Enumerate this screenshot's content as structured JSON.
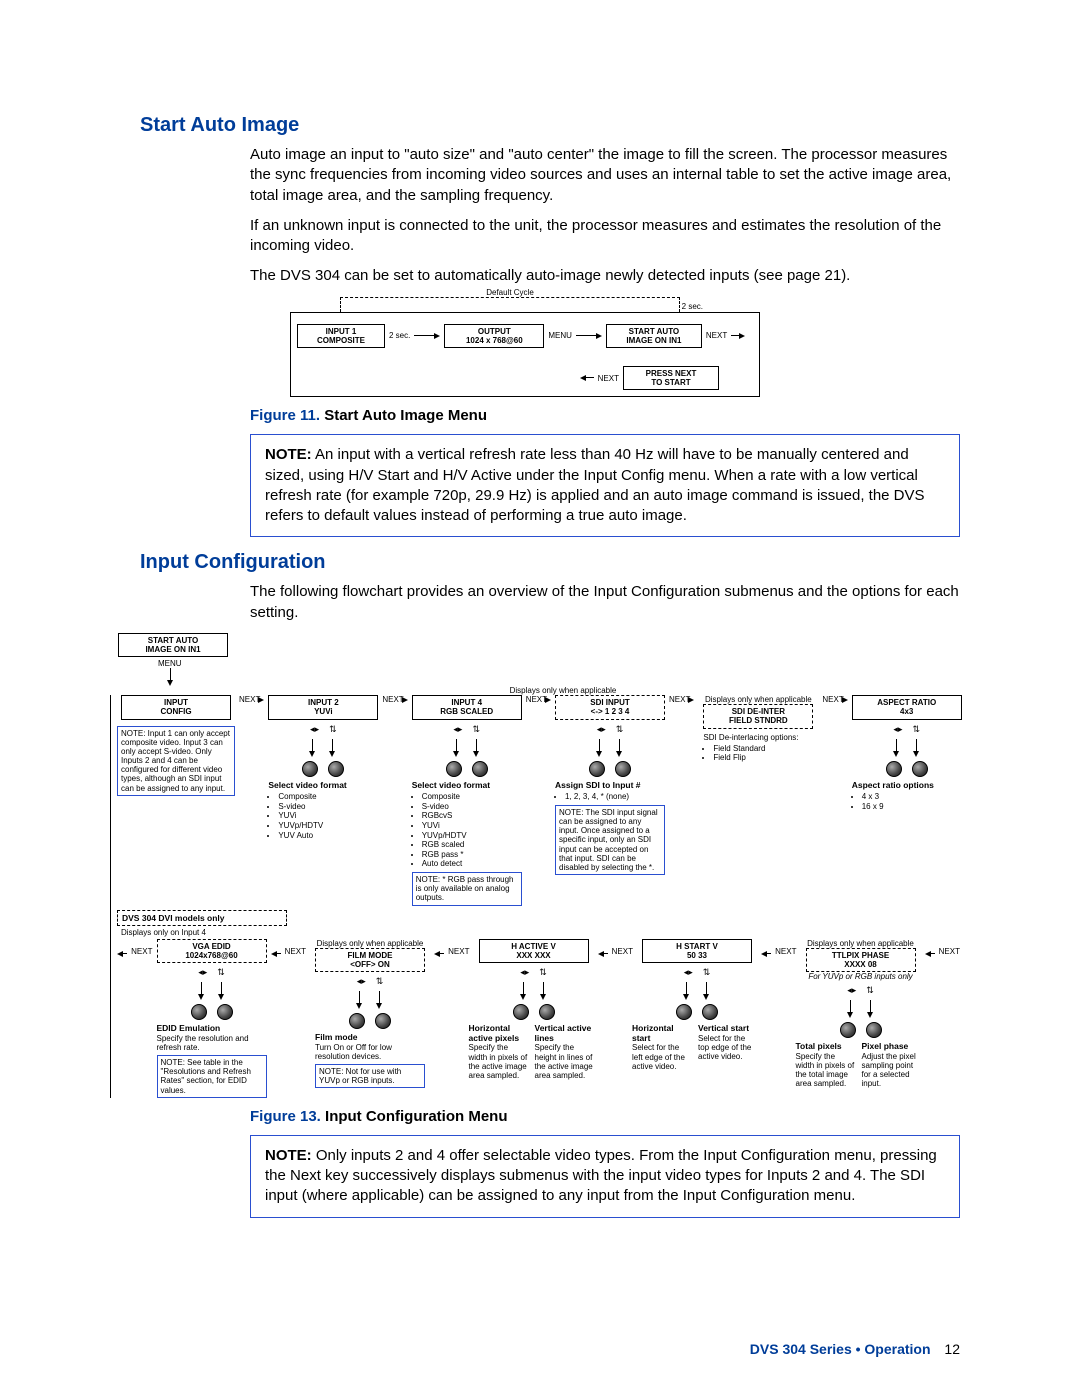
{
  "section1": {
    "heading": "Start Auto Image",
    "p1": "Auto image an input to \"auto size\" and \"auto center\" the image to fill the screen. The processor measures the sync frequencies from incoming video sources and uses an internal table to set the active image area, total image area, and the sampling frequency.",
    "p2": "If an unknown input is connected to the unit, the processor measures and estimates the resolution of the incoming video.",
    "p3": "The DVS 304 can be set to automatically auto-image newly detected inputs (see page 21)."
  },
  "fig11": {
    "default_cycle": "Default Cycle",
    "two_sec_a": "2 sec.",
    "two_sec_b": "2 sec.",
    "box1_l1": "INPUT 1",
    "box1_l2": "COMPOSITE",
    "box2_l1": "OUTPUT",
    "box2_l2": "1024 x 768@60",
    "menu": "MENU",
    "box3_l1": "START AUTO",
    "box3_l2": "IMAGE ON IN1",
    "next_a": "NEXT",
    "box4_l1": "PRESS NEXT",
    "box4_l2": "TO START",
    "next_b": "NEXT",
    "caption_num": "Figure 11.",
    "caption_text": " Start Auto Image Menu"
  },
  "note1": {
    "label": "NOTE:",
    "text": " An input with a vertical refresh rate less than 40 Hz will have to be manually centered and sized, using H/V Start and H/V Active under the Input Config menu. When a rate with a low vertical refresh rate (for example 720p, 29.9 Hz) is applied and an auto image command is issued, the DVS refers to default values instead of performing a true auto image."
  },
  "section2": {
    "heading": "Input Configuration",
    "p1": "The following flowchart provides an overview of the Input Configuration submenus and the options for each setting."
  },
  "fig13": {
    "start_box_l1": "START AUTO",
    "start_box_l2": "IMAGE ON IN1",
    "menu": "MENU",
    "next": "NEXT",
    "only_applicable": "Displays only when applicable",
    "row1": {
      "c0": {
        "l1": "INPUT",
        "l2": "CONFIG",
        "note": "NOTE: Input 1 can only accept composite video. Input 3 can only accept S-video. Only Inputs 2 and 4 can be configured for different video types, although an SDI input can be assigned to any input."
      },
      "c1": {
        "l1": "INPUT 2",
        "l2": "YUVi",
        "desc_title": "Select video format",
        "bullets": [
          "Composite",
          "S-video",
          "YUVi",
          "YUVp/HDTV",
          "YUV Auto"
        ]
      },
      "c2": {
        "l1": "INPUT 4",
        "l2": "RGB SCALED",
        "desc_title": "Select video format",
        "bullets": [
          "Composite",
          "S-video",
          "RGBcvS",
          "YUVi",
          "YUVp/HDTV",
          "RGB scaled",
          "RGB pass *",
          "Auto detect"
        ],
        "note": "NOTE: * RGB pass through is only available on analog outputs."
      },
      "c3": {
        "l1": "SDI INPUT",
        "l2": "<-> 1 2 3 4",
        "desc_title": "Assign SDI to Input #",
        "bullets": [
          "1, 2, 3, 4, * (none)"
        ],
        "note": "NOTE: The SDI input signal can be assigned to any input. Once assigned to a specific input, only an SDI input can be accepted on that input. SDI can be disabled by selecting the *."
      },
      "c4": {
        "l1": "SDI DE-INTER",
        "l2": "FIELD STNDRD",
        "desc_title": "SDI De-interlacing options:",
        "bullets": [
          "Field Standard",
          "Field Flip"
        ]
      },
      "c5": {
        "l1": "ASPECT RATIO",
        "l2": "4x3",
        "desc_title": "Aspect ratio options",
        "bullets": [
          "4 x 3",
          "16 x 9"
        ]
      }
    },
    "dvi_only": "DVS 304 DVI models only",
    "disp_input4": "Displays only on Input 4",
    "row2": {
      "c0": {
        "l1": "VGA EDID",
        "l2": "1024x768@60",
        "desc_title": "EDID Emulation",
        "desc": "Specify the resolution and refresh rate.",
        "note": "NOTE: See table in the \"Resolutions and Refresh Rates\" section, for EDID values."
      },
      "c1": {
        "l1": "FILM MODE",
        "l2": "<OFF> ON",
        "desc_title": "Film mode",
        "desc": "Turn On or Off for low resolution devices.",
        "note": "NOTE: Not for use with YUVp or RGB inputs."
      },
      "c2": {
        "l1": "H   ACTIVE   V",
        "l2": "XXX        XXX",
        "desc_title_a": "Horizontal active pixels",
        "desc_a": "Specify the width in pixels of the active image area sampled.",
        "desc_title_b": "Vertical active lines",
        "desc_b": "Specify the height in lines of the active image area sampled."
      },
      "c3": {
        "l1": "H   START   V",
        "l2": "50          33",
        "desc_title_a": "Horizontal start",
        "desc_a": "Select for the left edge of the active video.",
        "desc_title_b": "Vertical start",
        "desc_b": "Select for the top edge of the active video."
      },
      "c4": {
        "l1": "TTLPIX PHASE",
        "l2": "XXXX    08",
        "sub": "For YUVp or RGB inputs only",
        "desc_title_a": "Total pixels",
        "desc_a": "Specify the width in pixels of the total image area sampled.",
        "desc_title_b": "Pixel phase",
        "desc_b": "Adjust the pixel sampling point for a selected input."
      }
    },
    "caption_num": "Figure 13.",
    "caption_text": " Input Configuration Menu"
  },
  "note2": {
    "label": "NOTE:",
    "text": " Only inputs 2 and 4 offer selectable video types. From the Input Configuration menu, pressing the Next key successively displays submenus with the input video types for Inputs 2 and 4. The SDI input (where applicable) can be assigned to any input from the Input Configuration menu."
  },
  "footer": {
    "title": "DVS 304 Series • Operation",
    "page": "12"
  }
}
